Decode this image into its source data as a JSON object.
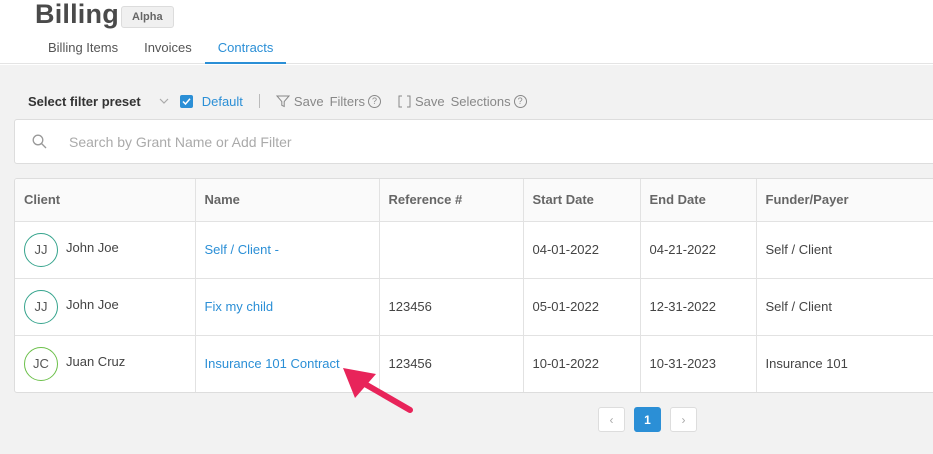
{
  "header": {
    "title": "Billing",
    "badge": "Alpha",
    "tabs": [
      {
        "label": "Billing Items"
      },
      {
        "label": "Invoices"
      },
      {
        "label": "Contracts",
        "active": true
      }
    ]
  },
  "filters": {
    "preset_label": "Select filter preset",
    "default_label": "Default",
    "default_checked": true,
    "save_label": "Save",
    "filters_label": "Filters",
    "selections_label": "Selections",
    "help_glyph": "?"
  },
  "search": {
    "placeholder": "Search by Grant Name or Add Filter",
    "value": ""
  },
  "table": {
    "columns": [
      "Client",
      "Name",
      "Reference #",
      "Start Date",
      "End Date",
      "Funder/Payer"
    ],
    "rows": [
      {
        "initials": "JJ",
        "client": "John Joe",
        "name": "Self / Client -",
        "reference": "",
        "start": "04-01-2022",
        "end": "04-21-2022",
        "funder": "Self / Client"
      },
      {
        "initials": "JJ",
        "client": "John Joe",
        "name": "Fix my child",
        "reference": "123456",
        "start": "05-01-2022",
        "end": "12-31-2022",
        "funder": "Self / Client"
      },
      {
        "initials": "JC",
        "client": "Juan Cruz",
        "name": "Insurance 101 Contract",
        "reference": "123456",
        "start": "10-01-2022",
        "end": "10-31-2023",
        "funder": "Insurance 101"
      }
    ]
  },
  "pagination": {
    "current_page": "1",
    "prev_glyph": "‹",
    "next_glyph": "›"
  },
  "colors": {
    "accent": "#2b8fd6",
    "annotation_arrow": "#e8245a",
    "avatar_border_jj": "#36a48d",
    "avatar_border_jc": "#6cc04a"
  }
}
